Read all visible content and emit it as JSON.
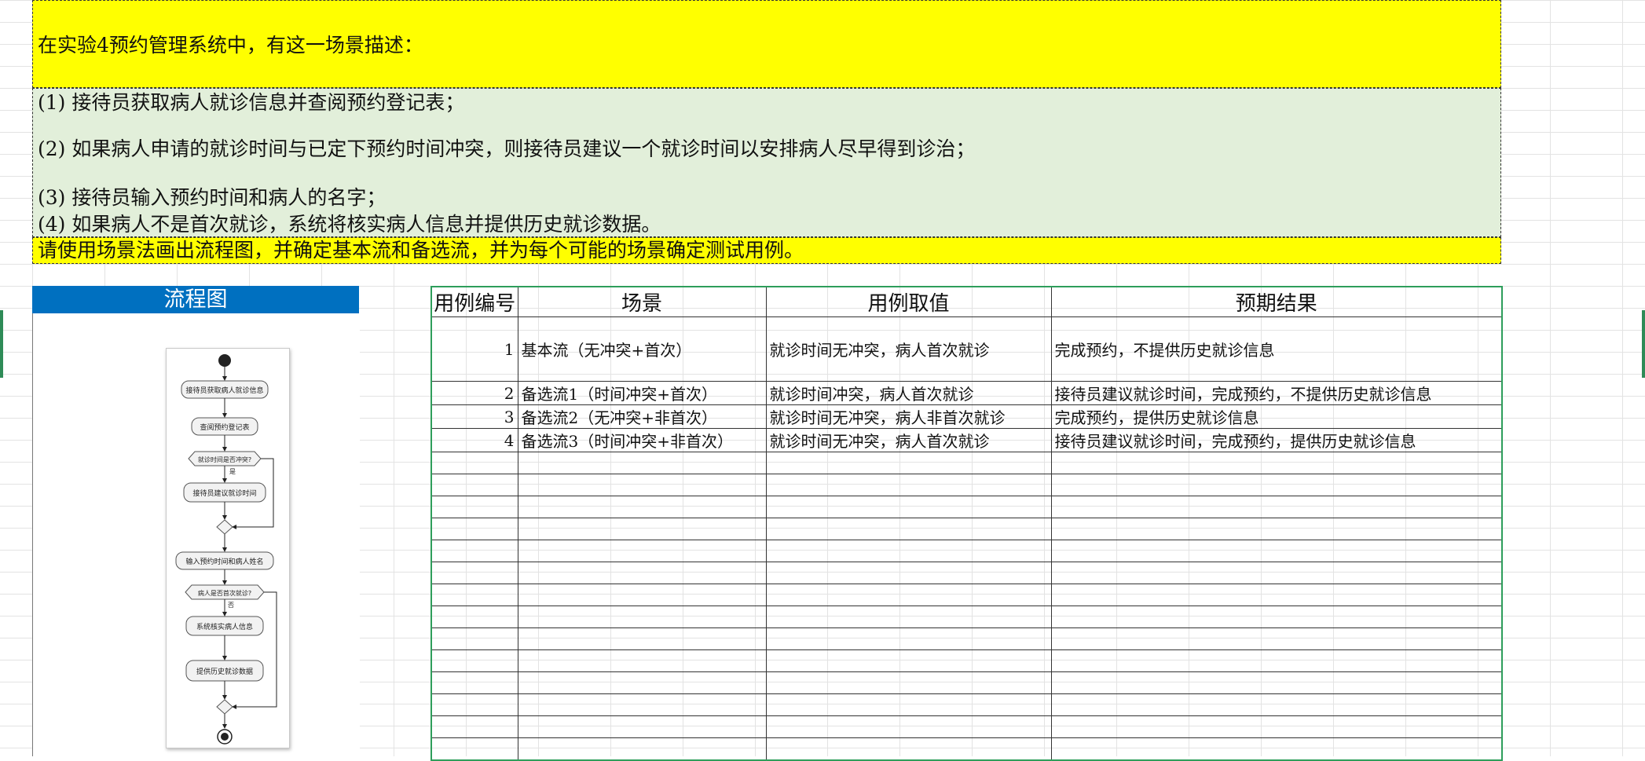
{
  "description": {
    "intro": "在实验4预约管理系统中，有这一场景描述：",
    "steps": [
      "(1) 接待员获取病人就诊信息并查阅预约登记表；",
      "(2) 如果病人申请的就诊时间与已定下预约时间冲突，则接待员建议一个就诊时间以安排病人尽早得到诊治；",
      "(3) 接待员输入预约时间和病人的名字；",
      "(4) 如果病人不是首次就诊，系统将核实病人信息并提供历史就诊数据。"
    ],
    "task": "请使用场景法画出流程图，并确定基本流和备选流，并为每个可能的场景确定测试用例。"
  },
  "flowchart": {
    "title": "流程图",
    "nodes": {
      "get_info": "接待员获取病人就诊信息",
      "check_register": "查阅预约登记表",
      "conflict_q": "就诊时间是否冲突?",
      "yes": "是",
      "suggest_time": "接待员建议就诊时间",
      "input_info": "输入预约时间和病人姓名",
      "first_visit_q": "病人是否首次就诊?",
      "no": "否",
      "verify_info": "系统核实病人信息",
      "history": "提供历史就诊数据"
    }
  },
  "table": {
    "headers": [
      "用例编号",
      "场景",
      "用例取值",
      "预期结果"
    ],
    "rows": [
      {
        "id": "1",
        "scene": "基本流（无冲突+首次）",
        "value": "就诊时间无冲突，病人首次就诊",
        "result": "完成预约，不提供历史就诊信息"
      },
      {
        "id": "2",
        "scene": "备选流1（时间冲突+首次）",
        "value": "就诊时间冲突，病人首次就诊",
        "result": "接待员建议就诊时间，完成预约，不提供历史就诊信息"
      },
      {
        "id": "3",
        "scene": "备选流2（无冲突+非首次）",
        "value": "就诊时间无冲突，病人非首次就诊",
        "result": "完成预约，提供历史就诊信息"
      },
      {
        "id": "4",
        "scene": "备选流3（时间冲突+非首次）",
        "value": "就诊时间无冲突，病人首次就诊",
        "result": "接待员建议就诊时间，完成预约，提供历史就诊信息"
      }
    ],
    "empty_rows": 14
  },
  "colors": {
    "yellow": "#ffff00",
    "light_green": "#e2efda",
    "header_blue": "#0070c0",
    "table_border": "#2e9e5b"
  }
}
